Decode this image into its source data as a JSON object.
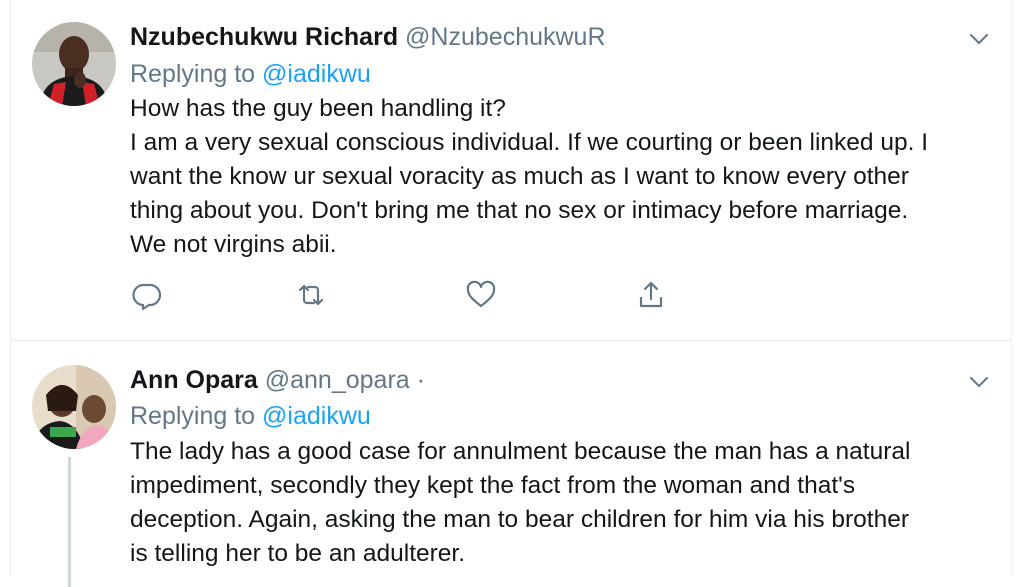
{
  "colors": {
    "text": "#14171a",
    "secondary": "#657786",
    "link": "#1da1f2",
    "divider": "#e6ecf0"
  },
  "tweets": [
    {
      "name": "Nzubechukwu Richard",
      "handle": "@NzubechukwuR",
      "handle_suffix": "",
      "replying_prefix": "Replying to",
      "replying_user": "@iadikwu",
      "lines": [
        "How has the guy been handling it?",
        "I am a very sexual conscious individual. If we courting or been linked up. I",
        "want the know ur sexual voracity  as much as I want to know every other",
        "thing about you. Don't bring me that no sex or intimacy before marriage.",
        "We not virgins abii."
      ],
      "icons": {
        "reply": "reply-icon",
        "retweet": "retweet-icon",
        "like": "heart-icon",
        "share": "share-icon",
        "menu": "chevron-down-icon"
      }
    },
    {
      "name": "Ann Opara",
      "handle": "@ann_opara",
      "handle_suffix": "·",
      "replying_prefix": "Replying to",
      "replying_user": "@iadikwu",
      "lines": [
        "The lady has a good case for annulment because the man has a natural",
        "impediment, secondly they kept the fact from the woman and that's",
        "deception. Again, asking the man to bear children for him via his brother",
        "is telling her to be an adulterer."
      ],
      "icons": {
        "menu": "chevron-down-icon"
      }
    }
  ]
}
